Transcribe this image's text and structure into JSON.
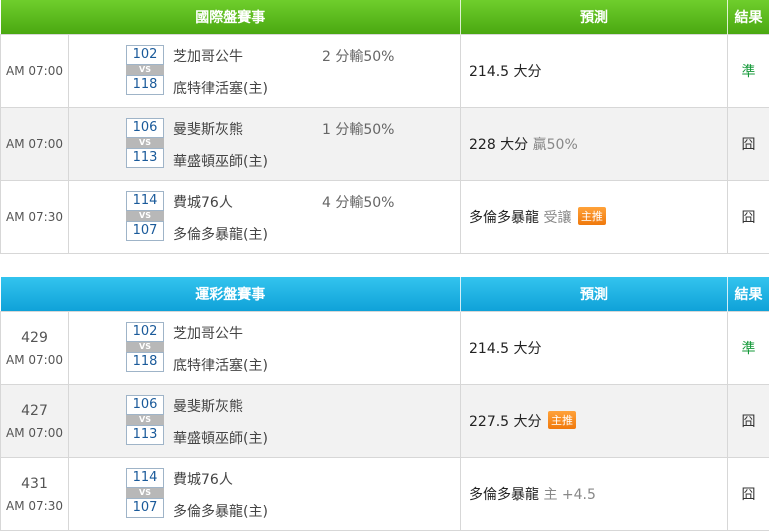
{
  "sections": [
    {
      "header": {
        "title": "國際盤賽事",
        "predict": "預測",
        "result": "結果"
      },
      "rows": [
        {
          "time": "AM 07:00",
          "home_num": "102",
          "away_num": "118",
          "vs": "VS",
          "team1": "芝加哥公牛",
          "team2": "底特律活塞(主)",
          "line": "2 分輸50%",
          "pred": "214.5 大分",
          "pred_extra": "",
          "badge": "",
          "result": "準"
        },
        {
          "time": "AM 07:00",
          "home_num": "106",
          "away_num": "113",
          "vs": "VS",
          "team1": "曼斐斯灰熊",
          "team2": "華盛頓巫師(主)",
          "line": "1 分輸50%",
          "pred": "228 大分",
          "pred_extra": "贏50%",
          "badge": "",
          "result": "囧"
        },
        {
          "time": "AM 07:30",
          "home_num": "114",
          "away_num": "107",
          "vs": "VS",
          "team1": "費城76人",
          "team2": "多倫多暴龍(主)",
          "line": "4 分輸50%",
          "pred": "多倫多暴龍",
          "pred_extra": "受讓",
          "badge": "主推",
          "result": "囧"
        }
      ]
    },
    {
      "header": {
        "title": "運彩盤賽事",
        "predict": "預測",
        "result": "結果"
      },
      "rows": [
        {
          "num": "429",
          "time": "AM 07:00",
          "home_num": "102",
          "away_num": "118",
          "vs": "VS",
          "team1": "芝加哥公牛",
          "team2": "底特律活塞(主)",
          "pred": "214.5 大分",
          "pred_extra": "",
          "badge": "",
          "result": "準"
        },
        {
          "num": "427",
          "time": "AM 07:00",
          "home_num": "106",
          "away_num": "113",
          "vs": "VS",
          "team1": "曼斐斯灰熊",
          "team2": "華盛頓巫師(主)",
          "pred": "227.5 大分",
          "pred_extra": "",
          "badge": "主推",
          "result": "囧"
        },
        {
          "num": "431",
          "time": "AM 07:30",
          "home_num": "114",
          "away_num": "107",
          "vs": "VS",
          "team1": "費城76人",
          "team2": "多倫多暴龍(主)",
          "pred": "多倫多暴龍",
          "pred_extra": "主 +4.5",
          "badge": "",
          "result": "囧"
        }
      ]
    }
  ]
}
